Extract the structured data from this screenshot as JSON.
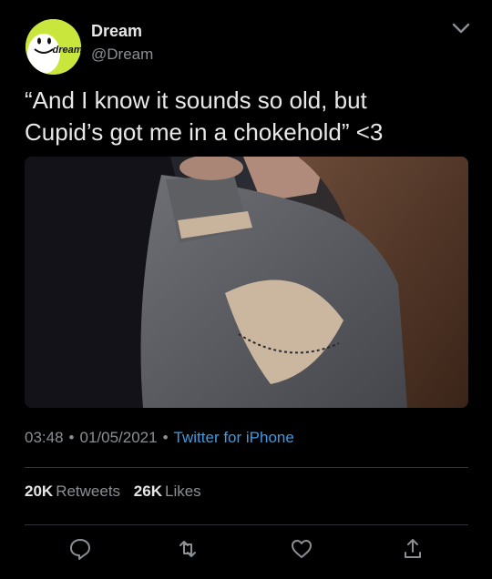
{
  "tweet": {
    "display_name": "Dream",
    "handle": "@Dream",
    "avatar_text": "dream",
    "text_line1": "“And I know it sounds so old, but",
    "text_line2": "Cupid’s got me in a chokehold” <3",
    "time": "03:48",
    "date": "01/05/2021",
    "separator": "•",
    "source": "Twitter for iPhone"
  },
  "stats": {
    "retweets_count": "20K",
    "retweets_label": "Retweets",
    "likes_count": "26K",
    "likes_label": "Likes"
  },
  "icons": {
    "menu": "chevron-down-icon",
    "reply": "reply-icon",
    "retweet": "retweet-icon",
    "like": "heart-icon",
    "share": "share-icon"
  },
  "colors": {
    "background": "#000000",
    "link": "#3c9be6",
    "secondary_text": "#8b8f94",
    "avatar": "#c8e63c"
  }
}
